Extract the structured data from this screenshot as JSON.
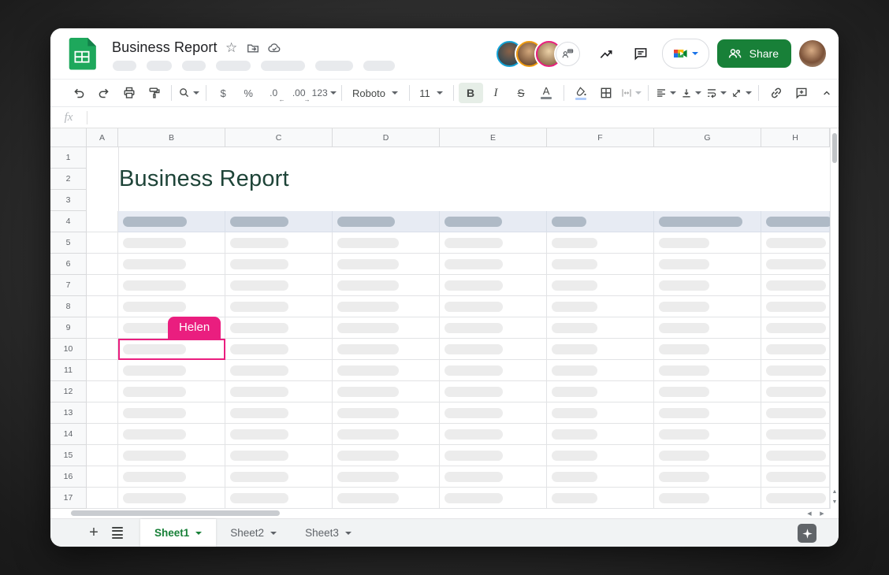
{
  "titlebar": {
    "title": "Business Report",
    "share_label": "Share",
    "menu_skeleton_count": 7,
    "collaborators": [
      {
        "id": "collaborator-1",
        "ring": "#12a3d8"
      },
      {
        "id": "collaborator-2",
        "ring": "#f09b0f"
      },
      {
        "id": "collaborator-3",
        "ring": "#ea1e7f"
      }
    ]
  },
  "toolbar": {
    "font_name": "Roboto",
    "font_size": "11",
    "number_format": "123",
    "currency": "$",
    "percent": "%",
    "decrease_decimal": ".0",
    "increase_decimal": ".00",
    "bold": "B",
    "italic": "I",
    "strikethrough": "S",
    "text_color": "A"
  },
  "formula_bar": {
    "fx": "fx",
    "value": ""
  },
  "grid": {
    "column_headers": [
      "A",
      "B",
      "C",
      "D",
      "E",
      "F",
      "G",
      "H"
    ],
    "row_count": 17,
    "sheet_title": "Business Report",
    "sheet_title_color": "#1e4438",
    "header_row": 4,
    "presence": {
      "user": "Helen",
      "color": "#ea1e7f",
      "cell": "B10"
    }
  },
  "sheetbar": {
    "tabs": [
      {
        "label": "Sheet1",
        "active": true
      },
      {
        "label": "Sheet2",
        "active": false
      },
      {
        "label": "Sheet3",
        "active": false
      }
    ]
  },
  "colors": {
    "accent_green": "#188038",
    "logo_green": "#1ea85c",
    "presence_pink": "#ea1e7f",
    "header_row_bg": "#e7ebf3",
    "header_pill": "#afbac6",
    "body_pill": "#ececec"
  }
}
